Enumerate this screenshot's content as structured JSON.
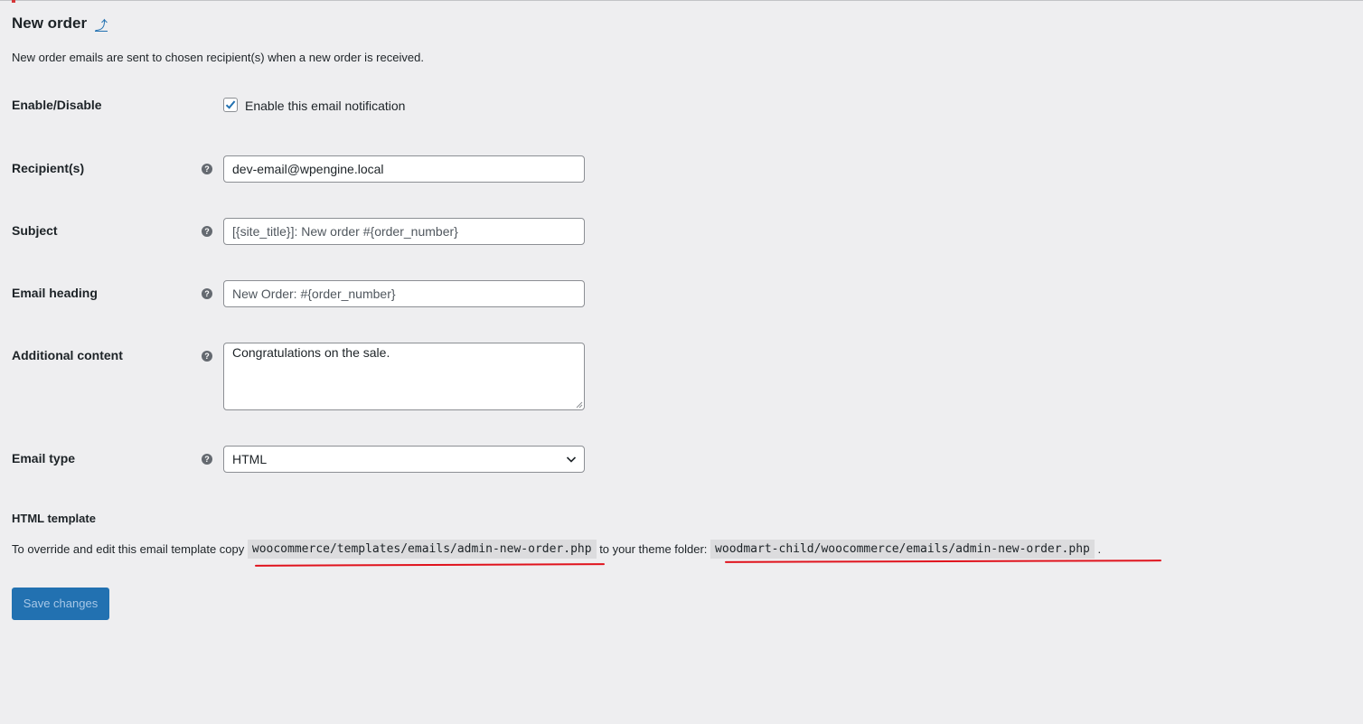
{
  "header": {
    "title": "New order",
    "back_link": "⤴",
    "description": "New order emails are sent to chosen recipient(s) when a new order is received."
  },
  "form": {
    "enable": {
      "label": "Enable/Disable",
      "checkbox_label": "Enable this email notification",
      "checked": true
    },
    "recipient": {
      "label": "Recipient(s)",
      "value": "dev-email@wpengine.local"
    },
    "subject": {
      "label": "Subject",
      "placeholder": "[{site_title}]: New order #{order_number}"
    },
    "heading": {
      "label": "Email heading",
      "placeholder": "New Order: #{order_number}"
    },
    "additional": {
      "label": "Additional content",
      "value": "Congratulations on the sale."
    },
    "email_type": {
      "label": "Email type",
      "selected": "HTML"
    }
  },
  "template": {
    "heading": "HTML template",
    "text_before": "To override and edit this email template copy",
    "source_path": "woocommerce/templates/emails/admin-new-order.php",
    "text_middle": "to your theme folder:",
    "dest_path": "woodmart-child/woocommerce/emails/admin-new-order.php",
    "text_end": "."
  },
  "save_button": "Save changes",
  "help_glyph": "?",
  "colors": {
    "accent": "#2271b1",
    "annotation": "#e0131d",
    "background": "#eeeef0"
  }
}
